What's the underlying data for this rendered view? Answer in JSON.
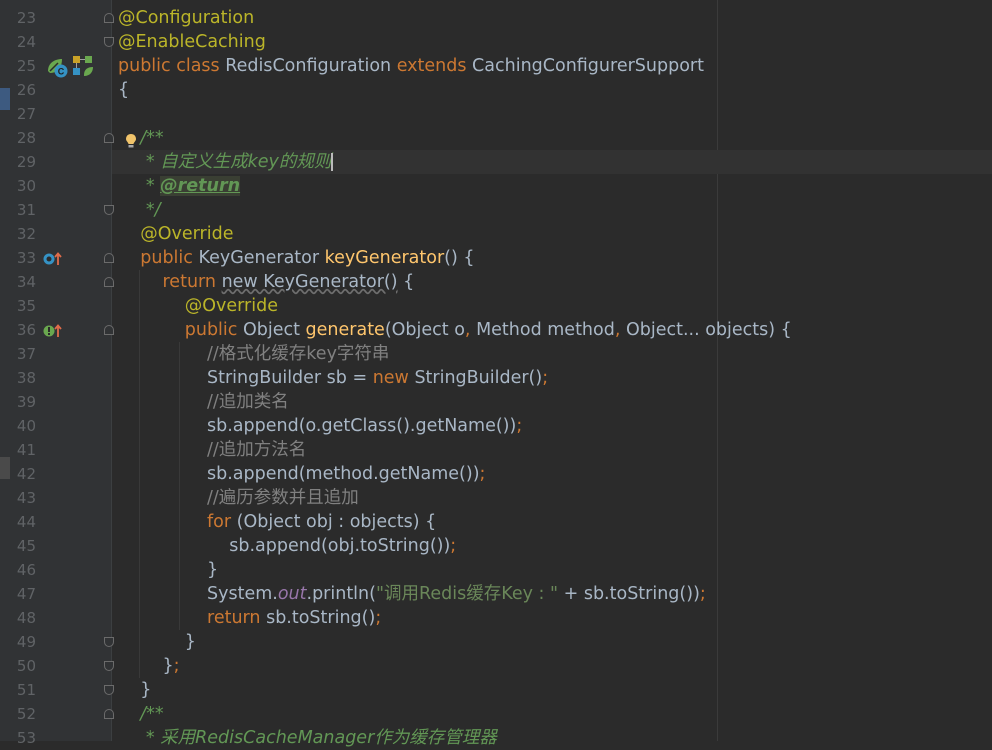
{
  "editor": {
    "lines": [
      {
        "n": "23",
        "tokens": [
          {
            "t": "@Configuration",
            "c": "ann"
          }
        ]
      },
      {
        "n": "24",
        "tokens": [
          {
            "t": "@EnableCaching",
            "c": "ann"
          }
        ]
      },
      {
        "n": "25",
        "tokens": [
          {
            "t": "public class ",
            "c": "kw"
          },
          {
            "t": "RedisConfiguration ",
            "c": "plain"
          },
          {
            "t": "extends ",
            "c": "kw"
          },
          {
            "t": "CachingConfigurerSupport",
            "c": "plain"
          }
        ]
      },
      {
        "n": "26",
        "tokens": [
          {
            "t": "{",
            "c": "plain"
          }
        ]
      },
      {
        "n": "27",
        "tokens": []
      },
      {
        "n": "28",
        "tokens": [
          {
            "t": "    /**",
            "c": "doc"
          }
        ]
      },
      {
        "n": "29",
        "tokens": [
          {
            "t": "     * 自定义生成key的规则",
            "c": "doc"
          }
        ]
      },
      {
        "n": "30",
        "tokens": [
          {
            "t": "     * ",
            "c": "doc"
          },
          {
            "t": "@return",
            "c": "doctag"
          }
        ]
      },
      {
        "n": "31",
        "tokens": [
          {
            "t": "     */",
            "c": "doc"
          }
        ]
      },
      {
        "n": "32",
        "tokens": [
          {
            "t": "    @Override",
            "c": "ann"
          }
        ]
      },
      {
        "n": "33",
        "tokens": [
          {
            "t": "    public ",
            "c": "kw"
          },
          {
            "t": "KeyGenerator ",
            "c": "plain"
          },
          {
            "t": "keyGenerator",
            "c": "fn"
          },
          {
            "t": "() {",
            "c": "plain"
          }
        ]
      },
      {
        "n": "34",
        "tokens": [
          {
            "t": "        return ",
            "c": "kw"
          },
          {
            "t": "new KeyGenerator()",
            "c": "dim"
          },
          {
            "t": " {",
            "c": "plain"
          }
        ]
      },
      {
        "n": "35",
        "tokens": [
          {
            "t": "            @Override",
            "c": "ann"
          }
        ]
      },
      {
        "n": "36",
        "tokens": [
          {
            "t": "            public ",
            "c": "kw"
          },
          {
            "t": "Object ",
            "c": "plain"
          },
          {
            "t": "generate",
            "c": "fn"
          },
          {
            "t": "(Object o",
            "c": "plain"
          },
          {
            "t": ", ",
            "c": "kw"
          },
          {
            "t": "Method method",
            "c": "plain"
          },
          {
            "t": ", ",
            "c": "kw"
          },
          {
            "t": "Object... objects) {",
            "c": "plain"
          }
        ]
      },
      {
        "n": "37",
        "tokens": [
          {
            "t": "                //格式化缓存key字符串",
            "c": "cmt"
          }
        ]
      },
      {
        "n": "38",
        "tokens": [
          {
            "t": "                StringBuilder sb = ",
            "c": "plain"
          },
          {
            "t": "new ",
            "c": "kw"
          },
          {
            "t": "StringBuilder()",
            "c": "plain"
          },
          {
            "t": ";",
            "c": "kw"
          }
        ]
      },
      {
        "n": "39",
        "tokens": [
          {
            "t": "                //追加类名",
            "c": "cmt"
          }
        ]
      },
      {
        "n": "40",
        "tokens": [
          {
            "t": "                sb.append(o.getClass().getName())",
            "c": "plain"
          },
          {
            "t": ";",
            "c": "kw"
          }
        ]
      },
      {
        "n": "41",
        "tokens": [
          {
            "t": "                //追加方法名",
            "c": "cmt"
          }
        ]
      },
      {
        "n": "42",
        "tokens": [
          {
            "t": "                sb.append(method.getName())",
            "c": "plain"
          },
          {
            "t": ";",
            "c": "kw"
          }
        ]
      },
      {
        "n": "43",
        "tokens": [
          {
            "t": "                //遍历参数并且追加",
            "c": "cmt"
          }
        ]
      },
      {
        "n": "44",
        "tokens": [
          {
            "t": "                for ",
            "c": "kw"
          },
          {
            "t": "(Object obj : objects) {",
            "c": "plain"
          }
        ]
      },
      {
        "n": "45",
        "tokens": [
          {
            "t": "                    sb.append(obj.toString())",
            "c": "plain"
          },
          {
            "t": ";",
            "c": "kw"
          }
        ]
      },
      {
        "n": "46",
        "tokens": [
          {
            "t": "                }",
            "c": "plain"
          }
        ]
      },
      {
        "n": "47",
        "tokens": [
          {
            "t": "                System.",
            "c": "plain"
          },
          {
            "t": "out",
            "c": "static"
          },
          {
            "t": ".println(",
            "c": "plain"
          },
          {
            "t": "\"调用Redis缓存Key : \"",
            "c": "str"
          },
          {
            "t": " + sb.toString())",
            "c": "plain"
          },
          {
            "t": ";",
            "c": "kw"
          }
        ]
      },
      {
        "n": "48",
        "tokens": [
          {
            "t": "                return ",
            "c": "kw"
          },
          {
            "t": "sb.toString()",
            "c": "plain"
          },
          {
            "t": ";",
            "c": "kw"
          }
        ]
      },
      {
        "n": "49",
        "tokens": [
          {
            "t": "            }",
            "c": "plain"
          }
        ]
      },
      {
        "n": "50",
        "tokens": [
          {
            "t": "        }",
            "c": "plain"
          },
          {
            "t": ";",
            "c": "kw"
          }
        ]
      },
      {
        "n": "51",
        "tokens": [
          {
            "t": "    }",
            "c": "plain"
          }
        ]
      },
      {
        "n": "52",
        "tokens": [
          {
            "t": "    /**",
            "c": "doc"
          }
        ]
      },
      {
        "n": "53",
        "tokens": [
          {
            "t": "     * 采用RedisCacheManager作为缓存管理器",
            "c": "doc"
          }
        ]
      }
    ],
    "gutter_icons": [
      {
        "line": "25",
        "icons": [
          "spring-bean-icon",
          "class-icon",
          "spring-config-icon"
        ]
      },
      {
        "line": "28",
        "icons": [
          "intention-bulb-icon"
        ]
      },
      {
        "line": "33",
        "icons": [
          "override-method-icon"
        ]
      },
      {
        "line": "36",
        "icons": [
          "implements-method-icon"
        ]
      }
    ],
    "caret_line": "29",
    "colors": {
      "background": "#2b2b2b",
      "gutter": "#313335",
      "keyword": "#cc7832",
      "annotation": "#bbb529",
      "method": "#ffc66d",
      "string": "#6a8759",
      "doc": "#629755",
      "comment": "#808080",
      "text": "#a9b7c6"
    }
  }
}
